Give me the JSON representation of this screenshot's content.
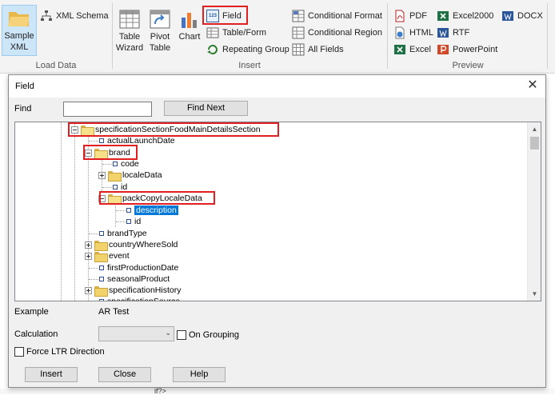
{
  "ribbon": {
    "load_data": {
      "sample_xml": "Sample XML",
      "xml_schema": "XML Schema",
      "group_label": "Load Data"
    },
    "insert": {
      "table_wizard": "Table Wizard",
      "pivot_table": "Pivot Table",
      "chart": "Chart",
      "field": "Field",
      "table_form": "Table/Form",
      "repeating_group": "Repeating Group",
      "conditional_format": "Conditional Format",
      "conditional_region": "Conditional Region",
      "all_fields": "All Fields",
      "group_label": "Insert"
    },
    "preview": {
      "pdf": "PDF",
      "html": "HTML",
      "excel": "Excel",
      "excel2000": "Excel2000",
      "rtf": "RTF",
      "powerpoint": "PowerPoint",
      "docx": "DOCX",
      "group_label": "Preview"
    },
    "field_icon_text": "123"
  },
  "dialog": {
    "title": "Field",
    "find_label": "Find",
    "find_value": "",
    "find_next": "Find Next",
    "tree": [
      {
        "label": "specificationSectionFoodMainDetailsSection"
      },
      {
        "label": "actualLaunchDate"
      },
      {
        "label": "brand"
      },
      {
        "label": "code"
      },
      {
        "label": "localeData"
      },
      {
        "label": "id"
      },
      {
        "label": "packCopyLocaleData"
      },
      {
        "label": "description"
      },
      {
        "label": "id"
      },
      {
        "label": "brandType"
      },
      {
        "label": "countryWhereSold"
      },
      {
        "label": "event"
      },
      {
        "label": "firstProductionDate"
      },
      {
        "label": "seasonalProduct"
      },
      {
        "label": "specificationHistory"
      },
      {
        "label": "specificationSource"
      }
    ],
    "example_label": "Example",
    "example_value": "AR Test",
    "calculation_label": "Calculation",
    "calculation_value": "",
    "on_grouping": "On Grouping",
    "force_ltr": "Force LTR Direction",
    "insert_btn": "Insert",
    "close_btn": "Close",
    "help_btn": "Help"
  },
  "background_text": "if?>",
  "colors": {
    "highlight_box": "#e02020",
    "selection": "#0078d7"
  }
}
